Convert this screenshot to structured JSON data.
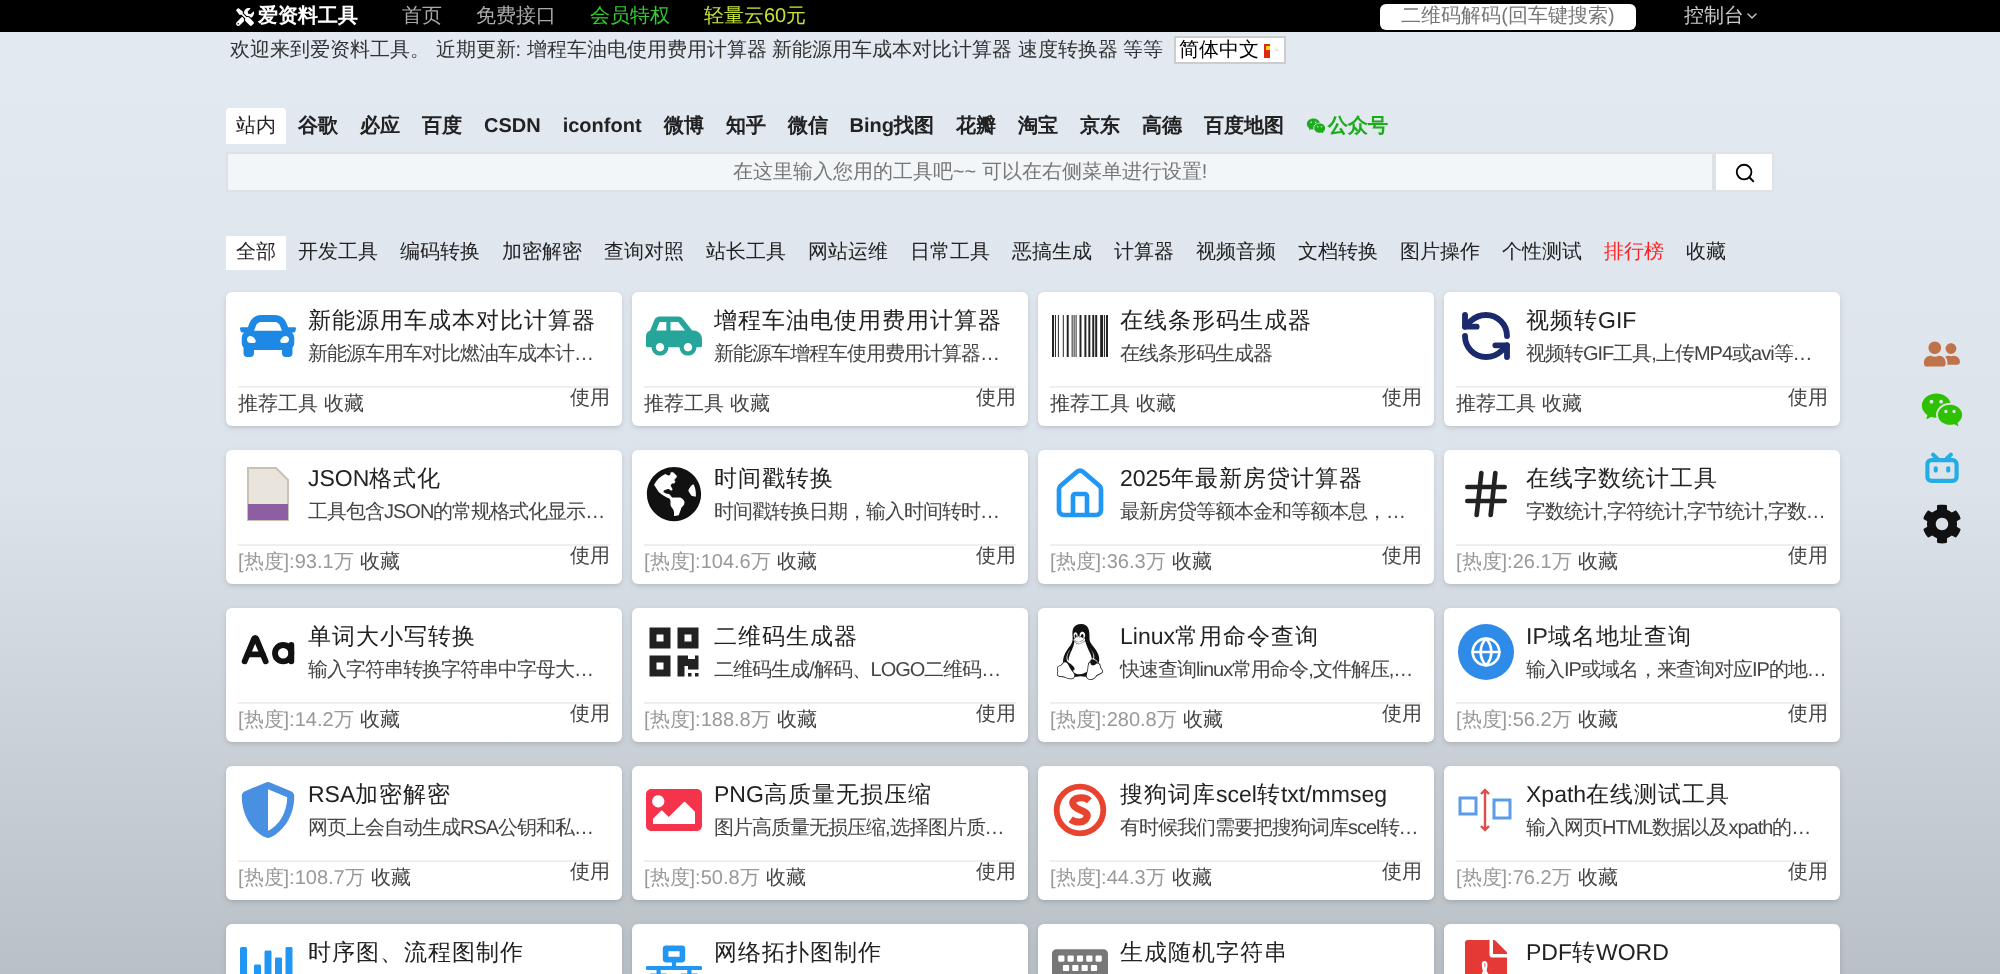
{
  "topbar": {
    "logo": "爱资料工具",
    "nav": [
      {
        "label": "首页",
        "color": "#aaaaaa"
      },
      {
        "label": "免费接口",
        "color": "#aaaaaa"
      },
      {
        "label": "会员特权",
        "color": "#33cc33"
      },
      {
        "label": "轻量云60元",
        "color": "#c6e23a"
      }
    ],
    "search": {
      "placeholder": "二维码解码(回车键搜索)"
    },
    "console": "控制台"
  },
  "notice": {
    "text": "欢迎来到爱资料工具。 近期更新: 增程车油电使用费用计算器 新能源用车成本对比计算器 速度转换器 等等",
    "language": "简体中文"
  },
  "engines": [
    {
      "label": "站内",
      "selected": true,
      "kind": "link"
    },
    {
      "label": "谷歌",
      "selected": false,
      "kind": "link"
    },
    {
      "label": "必应",
      "selected": false,
      "kind": "link"
    },
    {
      "label": "百度",
      "selected": false,
      "kind": "link"
    },
    {
      "label": "CSDN",
      "selected": false,
      "kind": "link"
    },
    {
      "label": "iconfont",
      "selected": false,
      "kind": "link"
    },
    {
      "label": "微博",
      "selected": false,
      "kind": "link"
    },
    {
      "label": "知乎",
      "selected": false,
      "kind": "link"
    },
    {
      "label": "微信",
      "selected": false,
      "kind": "link"
    },
    {
      "label": "Bing找图",
      "selected": false,
      "kind": "link"
    },
    {
      "label": "花瓣",
      "selected": false,
      "kind": "link"
    },
    {
      "label": "淘宝",
      "selected": false,
      "kind": "link"
    },
    {
      "label": "京东",
      "selected": false,
      "kind": "link"
    },
    {
      "label": "高德",
      "selected": false,
      "kind": "link"
    },
    {
      "label": "百度地图",
      "selected": false,
      "kind": "link"
    },
    {
      "label": "公众号",
      "selected": false,
      "kind": "wechat"
    }
  ],
  "search": {
    "placeholder": "在这里输入您用的工具吧~~ 可以在右侧菜单进行设置!"
  },
  "categories": [
    {
      "label": "全部",
      "selected": true,
      "kind": "normal"
    },
    {
      "label": "开发工具",
      "selected": false,
      "kind": "normal"
    },
    {
      "label": "编码转换",
      "selected": false,
      "kind": "normal"
    },
    {
      "label": "加密解密",
      "selected": false,
      "kind": "normal"
    },
    {
      "label": "查询对照",
      "selected": false,
      "kind": "normal"
    },
    {
      "label": "站长工具",
      "selected": false,
      "kind": "normal"
    },
    {
      "label": "网站运维",
      "selected": false,
      "kind": "normal"
    },
    {
      "label": "日常工具",
      "selected": false,
      "kind": "normal"
    },
    {
      "label": "恶搞生成",
      "selected": false,
      "kind": "normal"
    },
    {
      "label": "计算器",
      "selected": false,
      "kind": "normal"
    },
    {
      "label": "视频音频",
      "selected": false,
      "kind": "normal"
    },
    {
      "label": "文档转换",
      "selected": false,
      "kind": "normal"
    },
    {
      "label": "图片操作",
      "selected": false,
      "kind": "normal"
    },
    {
      "label": "个性测试",
      "selected": false,
      "kind": "normal"
    },
    {
      "label": "排行榜",
      "selected": false,
      "kind": "hot"
    },
    {
      "label": "收藏",
      "selected": false,
      "kind": "normal"
    }
  ],
  "cards": [
    {
      "title": "新能源用车成本对比计算器",
      "description": "新能源车用车对比燃油车成本计…",
      "tag": "推荐工具",
      "favorite": "收藏",
      "use": "使用"
    },
    {
      "title": "增程车油电使用费用计算器",
      "description": "新能源车增程车使用费用计算器…",
      "tag": "推荐工具",
      "favorite": "收藏",
      "use": "使用"
    },
    {
      "title": "在线条形码生成器",
      "description": "在线条形码生成器",
      "tag": "推荐工具",
      "favorite": "收藏",
      "use": "使用"
    },
    {
      "title": "视频转GIF",
      "description": "视频转GIF工具,上传MP4或avi等…",
      "tag": "推荐工具",
      "favorite": "收藏",
      "use": "使用"
    },
    {
      "title": "JSON格式化",
      "description": "工具包含JSON的常规格式化显示…",
      "heat": "[热度]:93.1万",
      "favorite": "收藏",
      "use": "使用"
    },
    {
      "title": "时间戳转换",
      "description": "时间戳转换日期，输入时间转时…",
      "heat": "[热度]:104.6万",
      "favorite": "收藏",
      "use": "使用"
    },
    {
      "title": "2025年最新房贷计算器",
      "description": "最新房贷等额本金和等额本息，…",
      "heat": "[热度]:36.3万",
      "favorite": "收藏",
      "use": "使用"
    },
    {
      "title": "在线字数统计工具",
      "description": "字数统计,字符统计,字节统计,字数…",
      "heat": "[热度]:26.1万",
      "favorite": "收藏",
      "use": "使用"
    },
    {
      "title": "单词大小写转换",
      "description": "输入字符串转换字符串中字母大…",
      "heat": "[热度]:14.2万",
      "favorite": "收藏",
      "use": "使用"
    },
    {
      "title": "二维码生成器",
      "description": "二维码生成/解码、LOGO二维码…",
      "heat": "[热度]:188.8万",
      "favorite": "收藏",
      "use": "使用"
    },
    {
      "title": "Linux常用命令查询",
      "description": "快速查询linux常用命令,文件解压,…",
      "heat": "[热度]:280.8万",
      "favorite": "收藏",
      "use": "使用"
    },
    {
      "title": "IP域名地址查询",
      "description": "输入IP或域名，来查询对应IP的地…",
      "heat": "[热度]:56.2万",
      "favorite": "收藏",
      "use": "使用"
    },
    {
      "title": "RSA加密解密",
      "description": "网页上会自动生成RSA公钥和私…",
      "heat": "[热度]:108.7万",
      "favorite": "收藏",
      "use": "使用"
    },
    {
      "title": "PNG高质量无损压缩",
      "description": "图片高质量无损压缩,选择图片质…",
      "heat": "[热度]:50.8万",
      "favorite": "收藏",
      "use": "使用"
    },
    {
      "title": "搜狗词库scel转txt/mmseg",
      "description": "有时候我们需要把搜狗词库scel转…",
      "heat": "[热度]:44.3万",
      "favorite": "收藏",
      "use": "使用"
    },
    {
      "title": "Xpath在线测试工具",
      "description": "输入网页HTML数据以及xpath的…",
      "heat": "[热度]:76.2万",
      "favorite": "收藏",
      "use": "使用"
    },
    {
      "title": "时序图、流程图制作"
    },
    {
      "title": "网络拓扑图制作"
    },
    {
      "title": "生成随机字符串"
    },
    {
      "title": "PDF转WORD"
    }
  ]
}
